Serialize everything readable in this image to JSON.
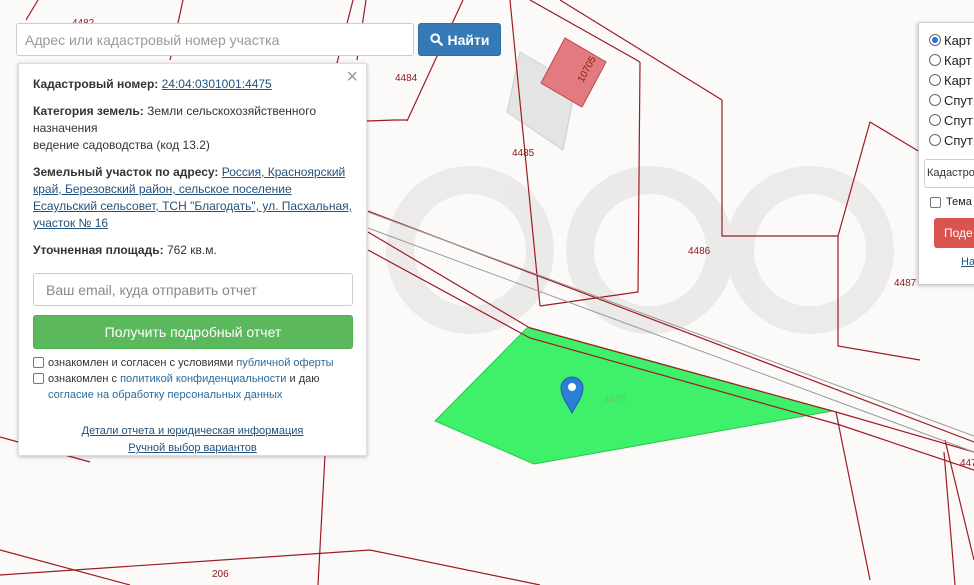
{
  "map": {
    "plot_labels": {
      "p4484": "4484",
      "p4485": "4485",
      "p4486": "4486",
      "p4487": "4487",
      "p4475": "4475",
      "p447": "447",
      "p206": "206",
      "p4482": "4482",
      "building": "10705"
    },
    "colors": {
      "boundary": "#9c1c22",
      "selected_plot": "#3ff06a",
      "building_red": "#e27a80",
      "building_shade": "#e4e4e4",
      "marker": "#2a7fd6"
    },
    "watermark": "Avito"
  },
  "search": {
    "placeholder": "Адрес или кадастровый номер участка",
    "button_label": "Найти",
    "button_icon": "search-icon"
  },
  "info": {
    "close": "×",
    "cadastral_label": "Кадастровый номер:",
    "cadastral_number": "24:04:0301001:4475",
    "category_label": "Категория земель:",
    "category_value": "Земли сельскохозяйственного назначения",
    "use_value": "ведение садоводства (код 13.2)",
    "address_label": "Земельный участок по адресу:",
    "address_value": "Россия, Красноярский край, Березовский район, сельское поселение Есаульский сельсовет, ТСН \"Благодать\", ул. Пасхальная, участок № 16",
    "area_label": "Уточненная площадь:",
    "area_value": "762 кв.м.",
    "email_placeholder": "Ваш email, куда отправить отчет",
    "report_button": "Получить подробный отчет",
    "consent1_text": "ознакомлен и согласен с условиями",
    "consent1_link": "публичной оферты",
    "consent2_text": "ознакомлен с",
    "consent2_link1": "политикой конфиденциальности",
    "consent2_mid": "и даю",
    "consent2_link2": "согласие на обработку персональных данных",
    "details_link": "Детали отчета и юридическая информация",
    "manual_link": "Ручной выбор вариантов"
  },
  "layers": {
    "options": [
      "Карт",
      "Карт",
      "Карт",
      "Спут",
      "Спут",
      "Спут"
    ],
    "selected_index": 0,
    "select_value": "Кадастро",
    "thematic_label": "Тема",
    "button_label": "Поде",
    "link": "На"
  }
}
